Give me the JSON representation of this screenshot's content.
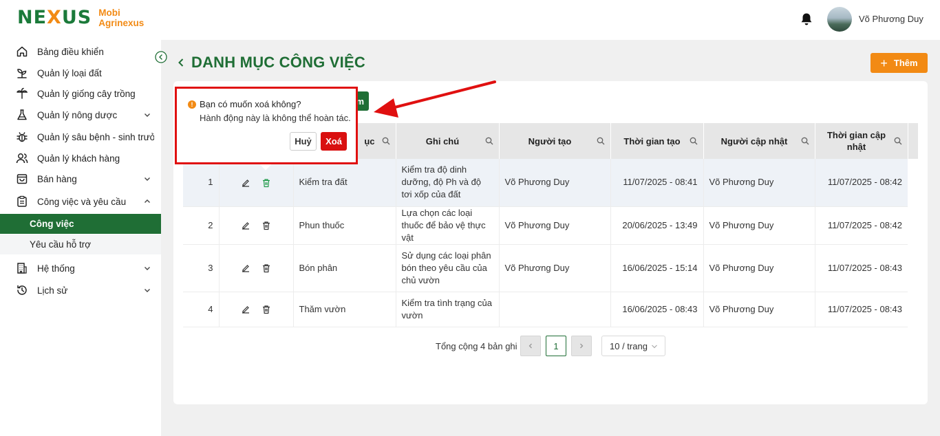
{
  "app": {
    "logo_mark_pre": "NE",
    "logo_mark_x": "X",
    "logo_mark_post": "US",
    "logo_line1": "Mobi",
    "logo_line2": "Agrinexus",
    "user_name": "Võ Phương Duy"
  },
  "sidebar": {
    "items": [
      {
        "label": "Bảng điều khiển",
        "icon": "home-icon"
      },
      {
        "label": "Quản lý loại đất",
        "icon": "sprout-icon"
      },
      {
        "label": "Quản lý giống cây trồng",
        "icon": "tree-icon"
      },
      {
        "label": "Quản lý nông dược",
        "icon": "flask-icon"
      },
      {
        "label": "Quản lý sâu bệnh - sinh trưởng",
        "icon": "bug-icon"
      },
      {
        "label": "Quản lý khách hàng",
        "icon": "users-icon"
      },
      {
        "label": "Bán hàng",
        "icon": "bag-icon"
      },
      {
        "label": "Công việc và yêu cầu",
        "icon": "clipboard-icon"
      },
      {
        "label": "Hệ thống",
        "icon": "building-icon"
      },
      {
        "label": "Lịch sử",
        "icon": "history-icon"
      }
    ],
    "sub_items": [
      {
        "label": "Công việc"
      },
      {
        "label": "Yêu cầu hỗ trợ"
      }
    ]
  },
  "page": {
    "title": "DANH MỤC CÔNG VIỆC",
    "add_label": "Thêm",
    "hidden_btn_fragment": "m"
  },
  "table": {
    "headers": {
      "danh_muc_fragment": "ục",
      "ghi_chu": "Ghi chú",
      "nguoi_tao": "Người tạo",
      "thoi_gian_tao": "Thời gian tạo",
      "nguoi_cap_nhat": "Người cập nhật",
      "thoi_gian_cap_nhat": "Thời gian cập nhật"
    },
    "rows": [
      {
        "stt": "1",
        "name": "Kiểm tra đất",
        "note": "Kiểm tra độ dinh dưỡng, độ Ph và độ tơi xốp của đất",
        "creator": "Võ Phương Duy",
        "created": "11/07/2025 - 08:41",
        "updater": "Võ Phương Duy",
        "updated": "11/07/2025 - 08:42"
      },
      {
        "stt": "2",
        "name": "Phun thuốc",
        "note": "Lựa chọn các loại thuốc để bảo vệ thực vật",
        "creator": "Võ Phương Duy",
        "created": "20/06/2025 - 13:49",
        "updater": "Võ Phương Duy",
        "updated": "11/07/2025 - 08:42"
      },
      {
        "stt": "3",
        "name": "Bón phân",
        "note": "Sử dụng các loại phân bón theo yêu cầu của chủ vườn",
        "creator": "Võ Phương Duy",
        "created": "16/06/2025 - 15:14",
        "updater": "Võ Phương Duy",
        "updated": "11/07/2025 - 08:43"
      },
      {
        "stt": "4",
        "name": "Thăm vườn",
        "note": "Kiểm tra tình trạng của vườn",
        "creator": "",
        "created": "16/06/2025 - 08:43",
        "updater": "Võ Phương Duy",
        "updated": "11/07/2025 - 08:43"
      }
    ]
  },
  "pagination": {
    "total": "Tổng cộng 4 bản ghi",
    "current": "1",
    "page_size": "10 / trang"
  },
  "popconfirm": {
    "title": "Bạn có muốn xoá không?",
    "description": "Hành động này là không thể hoàn tác.",
    "cancel": "Huỷ",
    "ok": "Xoá"
  },
  "colors": {
    "brand_green": "#1f6e35",
    "accent_orange": "#f28a14",
    "danger_red": "#d91010",
    "annotation_red": "#e01010"
  }
}
